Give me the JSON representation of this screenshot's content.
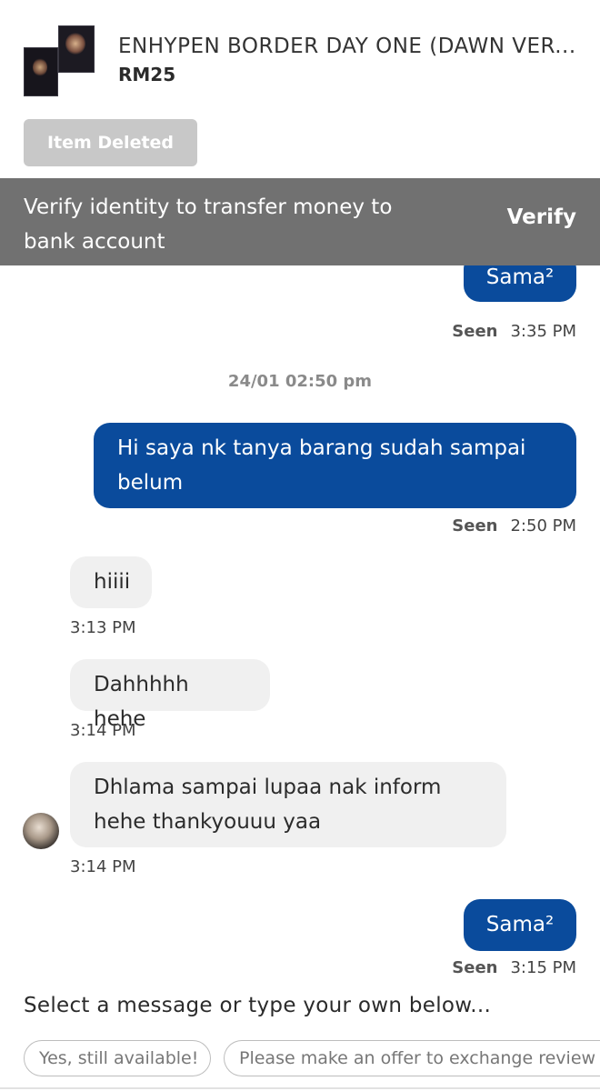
{
  "listing": {
    "title": "ENHYPEN BORDER DAY ONE (DAWN VER...",
    "price": "RM25",
    "status_button": "Item Deleted"
  },
  "verify_banner": {
    "text": "Verify identity to transfer money to bank account",
    "action": "Verify"
  },
  "chat": {
    "partial_top": {
      "text": "Sama²",
      "seen": "Seen",
      "time": "3:35 PM"
    },
    "date_separator": "24/01 02:50 pm",
    "messages": [
      {
        "from": "me",
        "text": "Hi saya nk tanya barang sudah sampai belum",
        "seen": "Seen",
        "time": "2:50 PM"
      },
      {
        "from": "them",
        "text": "hiiii",
        "time": "3:13 PM"
      },
      {
        "from": "them",
        "text": "Dahhhhh hehe",
        "time": "3:14 PM"
      },
      {
        "from": "them",
        "text": "Dhlama sampai lupaa nak inform hehe thankyouuu yaa",
        "time": "3:14 PM"
      },
      {
        "from": "me",
        "text": "Sama²",
        "seen": "Seen",
        "time": "3:15 PM"
      }
    ]
  },
  "composer": {
    "prompt": "Select a message or type your own below...",
    "quick_replies": [
      "Yes, still available!",
      "Please make an offer to exchange review la"
    ]
  },
  "colors": {
    "outgoing_bubble": "#0a4b9c",
    "incoming_bubble": "#f0f0f0",
    "banner": "#717171",
    "disabled_button": "#c8c8c8"
  }
}
